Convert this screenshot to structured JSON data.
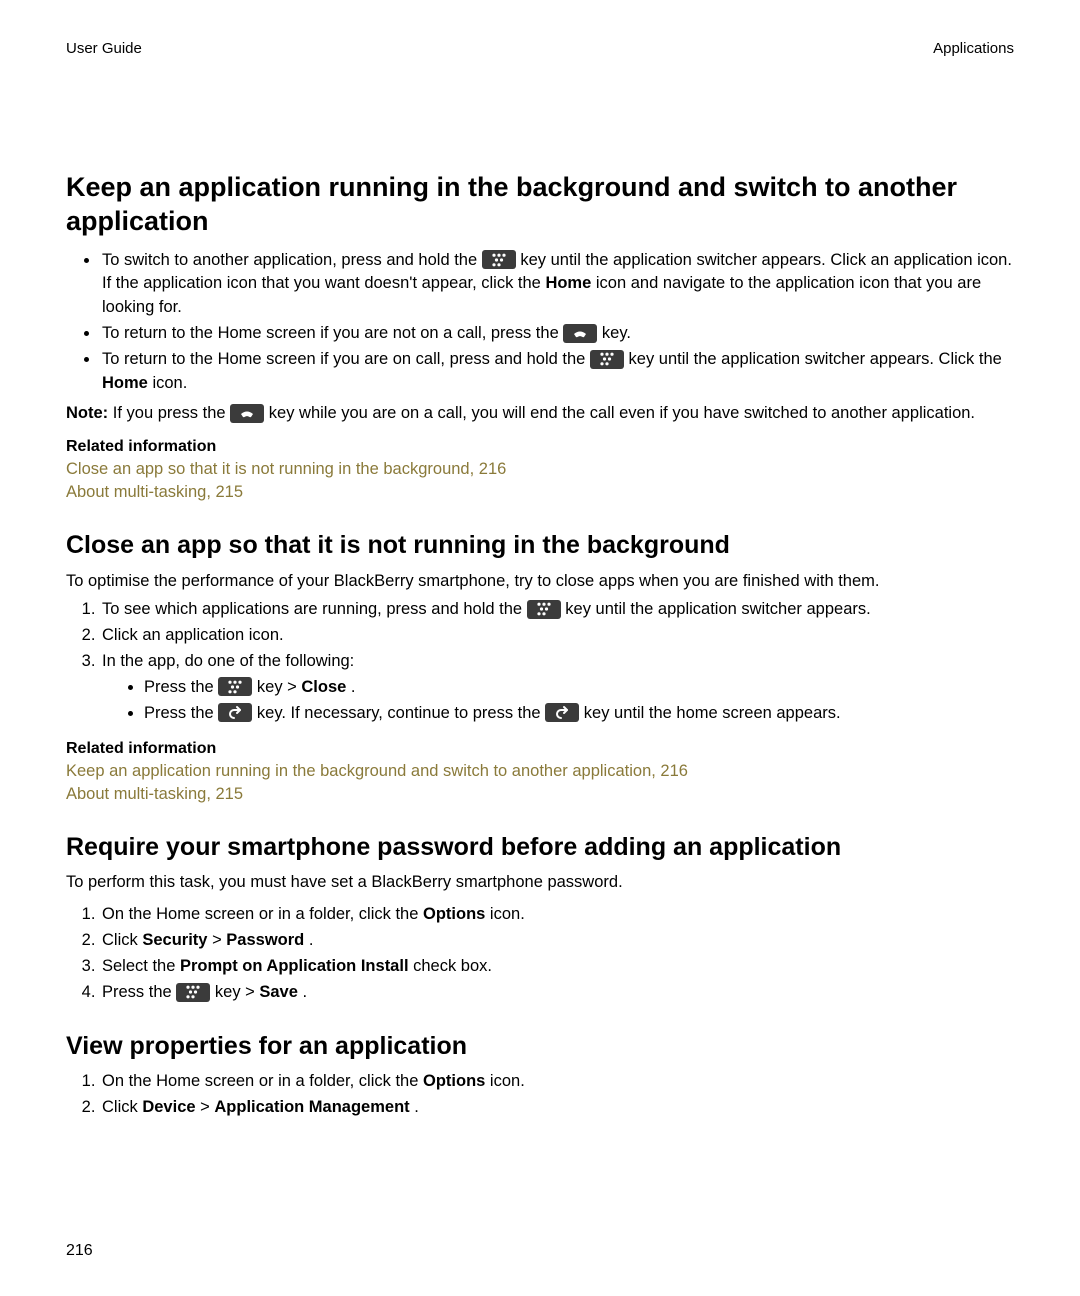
{
  "header": {
    "left": "User Guide",
    "right": "Applications"
  },
  "section1": {
    "heading": "Keep an application running in the background and switch to another application",
    "bullet1": {
      "pre": "To switch to another application, press and hold the ",
      "post1": " key until the application switcher appears. Click an application icon. If the application icon that you want doesn't appear, click the ",
      "home": "Home",
      "post2": " icon and navigate to the application icon that you are looking for."
    },
    "bullet2": {
      "pre": "To return to the Home screen if you are not on a call, press the ",
      "post": " key."
    },
    "bullet3": {
      "pre": "To return to the Home screen if you are on call, press and hold the ",
      "post1": " key until the application switcher appears. Click the ",
      "home": "Home",
      "post2": " icon."
    },
    "note": {
      "label": "Note:",
      "pre": " If you press the ",
      "post": " key while you are on a call, you will end the call even if you have switched to another application."
    },
    "related_label": "Related information",
    "links": [
      "Close an app so that it is not running in the background, 216",
      "About multi-tasking, 215"
    ]
  },
  "section2": {
    "heading": "Close an app so that it is not running in the background",
    "intro": "To optimise the performance of your BlackBerry smartphone, try to close apps when you are finished with them.",
    "step1": {
      "pre": "To see which applications are running, press and hold the ",
      "post": " key until the application switcher appears."
    },
    "step2": "Click an application icon.",
    "step3": "In the app, do one of the following:",
    "sub1": {
      "pre": "Press the ",
      "mid": " key > ",
      "close": "Close",
      "end": "."
    },
    "sub2": {
      "pre": "Press the ",
      "mid": " key. If necessary, continue to press the ",
      "post": " key until the home screen appears."
    },
    "related_label": "Related information",
    "links": [
      "Keep an application running in the background and switch to another application, 216",
      "About multi-tasking, 215"
    ]
  },
  "section3": {
    "heading": "Require your smartphone password before adding an application",
    "intro": "To perform this task, you must have set a BlackBerry smartphone password.",
    "steps": {
      "s1": {
        "pre": "On the Home screen or in a folder, click the ",
        "b1": "Options",
        "post": " icon."
      },
      "s2": {
        "pre": "Click ",
        "b1": "Security",
        "mid": " > ",
        "b2": "Password",
        "end": "."
      },
      "s3": {
        "pre": "Select the ",
        "b1": "Prompt on Application Install",
        "post": " check box."
      },
      "s4": {
        "pre": "Press the ",
        "mid": " key > ",
        "b1": "Save",
        "end": "."
      }
    }
  },
  "section4": {
    "heading": "View properties for an application",
    "steps": {
      "s1": {
        "pre": "On the Home screen or in a folder, click the ",
        "b1": "Options",
        "post": " icon."
      },
      "s2": {
        "pre": "Click ",
        "b1": "Device",
        "mid": " > ",
        "b2": "Application Management",
        "end": "."
      }
    }
  },
  "footer": {
    "page": "216"
  }
}
